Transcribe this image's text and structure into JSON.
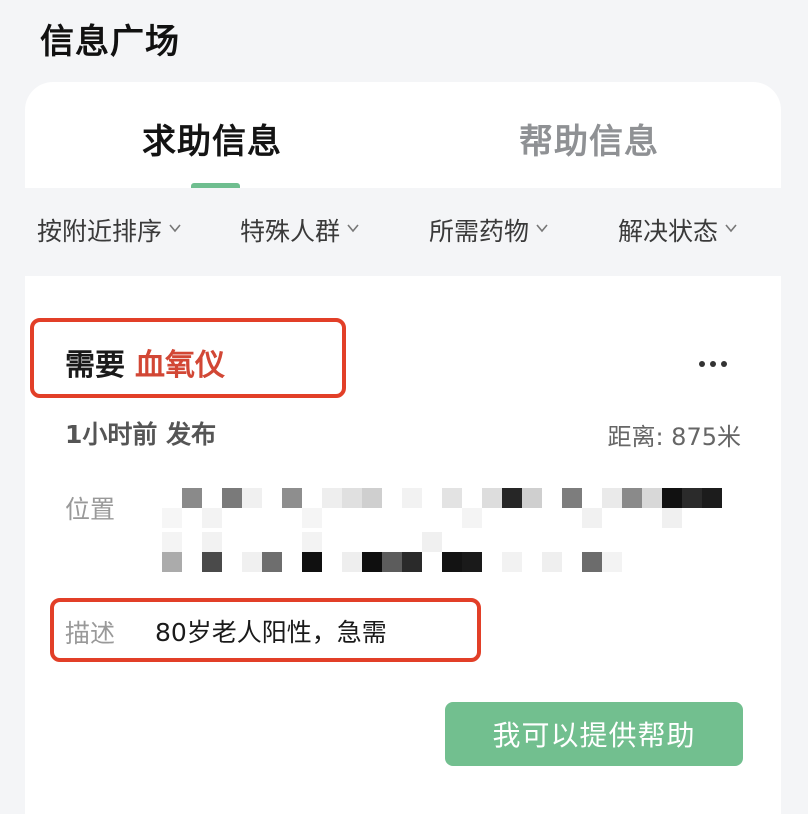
{
  "page": {
    "title": "信息广场"
  },
  "tabs": [
    {
      "label": "求助信息",
      "active": true
    },
    {
      "label": "帮助信息",
      "active": false
    }
  ],
  "filters": [
    {
      "label": "按附近排序"
    },
    {
      "label": "特殊人群"
    },
    {
      "label": "所需药物"
    },
    {
      "label": "解决状态"
    }
  ],
  "request": {
    "need_prefix": "需要",
    "need_item": "血氧仪",
    "posted": "1小时前 发布",
    "distance": "距离: 875米",
    "location_label": "位置",
    "description_label": "描述",
    "description": "80岁老人阳性，急需",
    "help_button": "我可以提供帮助"
  },
  "icons": {
    "more": "more-horizontal-icon",
    "filter_arrow": "chevron-down-icon"
  },
  "colors": {
    "accent": "#72bf8f",
    "need_item": "#d24735",
    "highlight": "#e23f28"
  }
}
